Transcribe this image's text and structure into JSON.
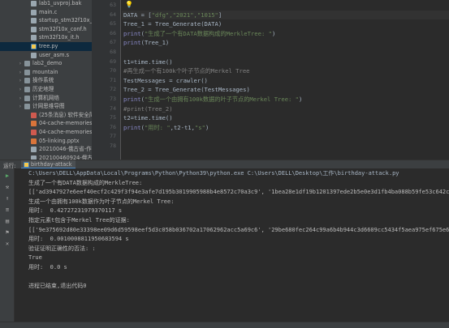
{
  "project": {
    "items": [
      {
        "label": "lab1_uvproj.bak",
        "icon": "file-icon",
        "arrow": ""
      },
      {
        "label": "main.c",
        "icon": "file-icon",
        "arrow": ""
      },
      {
        "label": "startup_stm32f10x_m",
        "icon": "file-icon",
        "arrow": ""
      },
      {
        "label": "stm32f10x_conf.h",
        "icon": "file-icon",
        "arrow": ""
      },
      {
        "label": "stm32f10x_it.h",
        "icon": "file-icon",
        "arrow": ""
      },
      {
        "label": "tree.py",
        "icon": "python-file-icon",
        "arrow": "",
        "selected": true
      },
      {
        "label": "user_asm.s",
        "icon": "file-icon",
        "arrow": ""
      },
      {
        "label": "lab2_demo",
        "icon": "folder-icon",
        "arrow": "›"
      },
      {
        "label": "mountain",
        "icon": "folder-icon",
        "arrow": "›"
      },
      {
        "label": "操作系统",
        "icon": "folder-icon",
        "arrow": "›"
      },
      {
        "label": "历史地理",
        "icon": "folder-icon",
        "arrow": "›"
      },
      {
        "label": "计算机网络",
        "icon": "folder-icon",
        "arrow": "›"
      },
      {
        "label": "计网思维导图",
        "icon": "folder-icon",
        "arrow": "›"
      },
      {
        "label": "(25条消息) 软件安全简单",
        "icon": "pdf-icon",
        "arrow": ""
      },
      {
        "label": "04-cache-memories.ppt",
        "icon": "ppt-icon",
        "arrow": ""
      },
      {
        "label": "04-cache-memories zh.p",
        "icon": "pdf-icon",
        "arrow": ""
      },
      {
        "label": "05-linking.pptx",
        "icon": "ppt-icon",
        "arrow": ""
      },
      {
        "label": "20210046-俄古省-作业-",
        "icon": "file-icon",
        "arrow": ""
      },
      {
        "label": "202100460924-俄古省-",
        "icon": "file-icon",
        "arrow": ""
      }
    ]
  },
  "editor": {
    "line_numbers": [
      "63",
      "64",
      "65",
      "66",
      "67",
      "68",
      "69",
      "70",
      "71",
      "72",
      "73",
      "74",
      "75",
      "76",
      "77",
      "78"
    ],
    "lines": [
      [],
      [
        {
          "t": "DATA = [",
          "c": "c-var"
        },
        {
          "t": "\"dfg\",\"2021\",\"1015\"",
          "c": "c-str"
        },
        {
          "t": "]",
          "c": "c-var"
        }
      ],
      [
        {
          "t": "Tree_1 = Tree_Generate(DATA)",
          "c": "c-var"
        }
      ],
      [
        {
          "t": "print",
          "c": "c-fn"
        },
        {
          "t": "(",
          "c": "c-var"
        },
        {
          "t": "\"生成了一个有DATA数据构成的MerkleTree: \"",
          "c": "c-str"
        },
        {
          "t": ")",
          "c": "c-var"
        }
      ],
      [
        {
          "t": "print",
          "c": "c-fn"
        },
        {
          "t": "(Tree_1)",
          "c": "c-var"
        }
      ],
      [],
      [
        {
          "t": "t1=time.time()",
          "c": "c-var"
        }
      ],
      [
        {
          "t": "#再生成一个有100k个叶子节点的Merkel Tree",
          "c": "c-com"
        }
      ],
      [
        {
          "t": "TestMessages = crawler()",
          "c": "c-var"
        }
      ],
      [
        {
          "t": "Tree_2 = Tree_Generate(TestMessages)",
          "c": "c-var"
        }
      ],
      [
        {
          "t": "print",
          "c": "c-fn"
        },
        {
          "t": "(",
          "c": "c-var"
        },
        {
          "t": "\"生成一个由拥有100k数据的叶子节点的Merkel Tree: \"",
          "c": "c-str"
        },
        {
          "t": ")",
          "c": "c-var"
        }
      ],
      [
        {
          "t": "#print(Tree_2)",
          "c": "c-com"
        }
      ],
      [
        {
          "t": "t2=time.time()",
          "c": "c-var"
        }
      ],
      [
        {
          "t": "print",
          "c": "c-fn"
        },
        {
          "t": "(",
          "c": "c-var"
        },
        {
          "t": "\"用时: \"",
          "c": "c-str"
        },
        {
          "t": ",t2-t1,",
          "c": "c-var"
        },
        {
          "t": "\"s\"",
          "c": "c-str"
        },
        {
          "t": ")",
          "c": "c-var"
        }
      ],
      [],
      []
    ]
  },
  "run": {
    "label": "运行:",
    "tab_title": "birthday-attack",
    "output": [
      "C:\\Users\\DELL\\AppData\\Local\\Programs\\Python\\Python39\\python.exe C:\\Users\\DELL\\Desktop\\工作\\birthday-attack.py",
      "生成了一个有DATA数据构成的MerkleTree:",
      "[['ad3947927e6eef40ecf2c429f3f94e3afe7d195b3019905988b4e8572c70a3c9', '1bea28e1df19b1201397ede2b5e0e3d1fb4ba088b59fe53c642c32",
      "生成一个由拥有100k数据作为叶子节点的Merkel Tree:",
      "用时:  0.42727231979370117 s",
      "指定元素t包含于Merkel Tree的证据:",
      "[['9e375692d80e33398ee09d6d59598eef5d3c058b036702a17062962acc5a69c6', '29be680fec264c99a6b4b944c3d6609cc5434f5aea975ef675e62a",
      "用时:  0.0010008811950683594 s",
      "验证证明正确性的否法: :",
      "True",
      "用时:  0.0 s",
      "",
      "进程已结束,退出代码0"
    ]
  }
}
